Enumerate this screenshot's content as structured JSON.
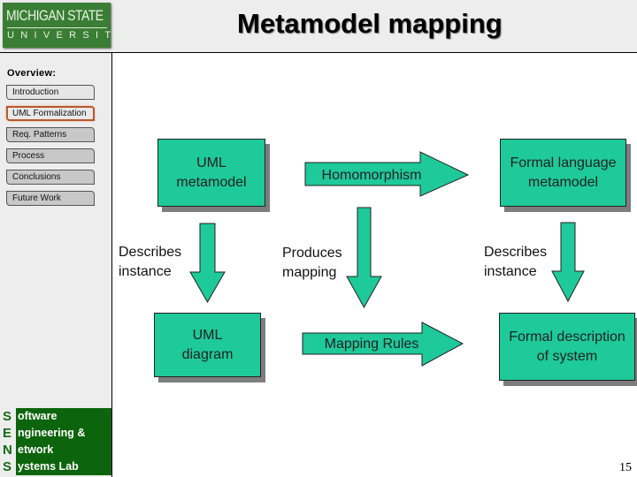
{
  "header": {
    "logo_line1": "MICHIGAN STATE",
    "logo_line2": "UNIVERSITY",
    "title": "Metamodel mapping"
  },
  "sidebar": {
    "overview_label": "Overview:",
    "items": [
      {
        "label": "Introduction",
        "state": "normal"
      },
      {
        "label": "UML Formalization",
        "state": "active"
      },
      {
        "label": "Req. Patterns",
        "state": "normal"
      },
      {
        "label": "Process",
        "state": "normal"
      },
      {
        "label": "Conclusions",
        "state": "normal"
      },
      {
        "label": "Future Work",
        "state": "normal"
      }
    ],
    "lab": [
      {
        "letter": "S",
        "rest": "oftware"
      },
      {
        "letter": "E",
        "rest": "ngineering &"
      },
      {
        "letter": "N",
        "rest": "etwork"
      },
      {
        "letter": "S",
        "rest": "ystems Lab"
      }
    ]
  },
  "diagram": {
    "nodes": {
      "uml_metamodel": "UML\nmetamodel",
      "formal_language_metamodel": "Formal language\nmetamodel",
      "uml_diagram": "UML\ndiagram",
      "formal_description": "Formal description\nof system"
    },
    "arrows": {
      "homomorphism": "Homomorphism",
      "mapping_rules": "Mapping Rules"
    },
    "labels": {
      "describes_instance_left": "Describes\ninstance",
      "produces_mapping": "Produces\nmapping",
      "describes_instance_right": "Describes\ninstance"
    },
    "colors": {
      "shape_fill": "#1ec99a",
      "shadow": "#7d7d7d",
      "lab_green": "#0c640c",
      "logo_green": "#3a7d34",
      "active_border": "#b8582e"
    }
  },
  "footer": {
    "page_number": "15"
  }
}
